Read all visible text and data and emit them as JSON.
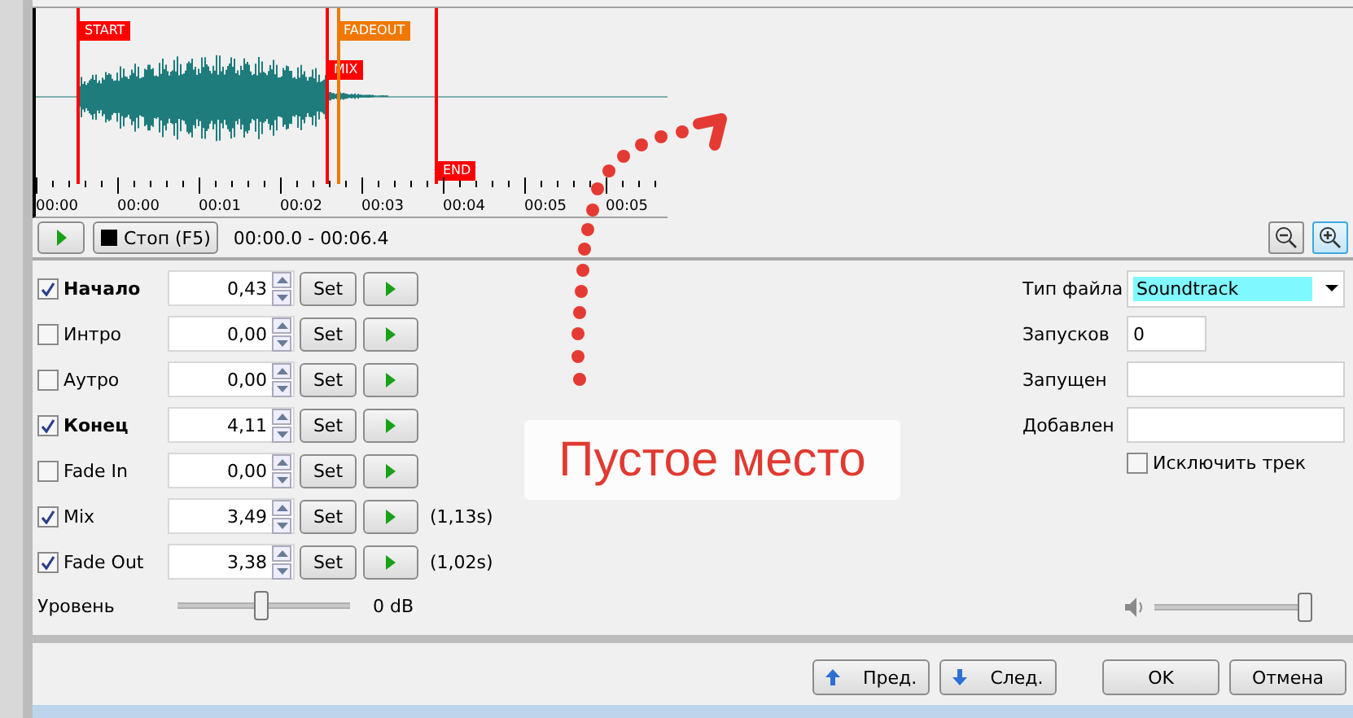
{
  "waveform": {
    "markers": [
      {
        "label": "START",
        "color": "#ff0000"
      },
      {
        "label": "MIX",
        "color": "#ff0000"
      },
      {
        "label": "FADEOUT",
        "color": "#f07800"
      },
      {
        "label": "END",
        "color": "#ff0000"
      }
    ],
    "ticks": [
      "00:00",
      "00:00",
      "00:01",
      "00:02",
      "00:03",
      "00:04",
      "00:05",
      "00:05"
    ]
  },
  "transport": {
    "stop_label": "Стоп (F5)",
    "range": "00:00.0 - 00:06.4"
  },
  "cues": [
    {
      "label": "Начало",
      "checked": true,
      "bold": true,
      "value": "0,43",
      "button": "Set"
    },
    {
      "label": "Интро",
      "checked": false,
      "bold": false,
      "value": "0,00",
      "button": "Set"
    },
    {
      "label": "Аутро",
      "checked": false,
      "bold": false,
      "value": "0,00",
      "button": "Set"
    },
    {
      "label": "Конец",
      "checked": true,
      "bold": true,
      "value": "4,11",
      "button": "Set"
    },
    {
      "label": "Fade In",
      "checked": false,
      "bold": false,
      "value": "0,00",
      "button": "Set"
    },
    {
      "label": "Mix",
      "checked": true,
      "bold": false,
      "value": "3,49",
      "button": "Set",
      "note": "(1,13s)"
    },
    {
      "label": "Fade Out",
      "checked": true,
      "bold": false,
      "value": "3,38",
      "button": "Set",
      "note": "(1,02s)"
    }
  ],
  "level": {
    "label": "Уровень",
    "level": 0.48,
    "reading": "0 dB"
  },
  "properties": {
    "file_type_label": "Тип файла",
    "file_type": "Soundtrack",
    "plays_label": "Запусков",
    "plays": "0",
    "played_label": "Запущен",
    "added_label": "Добавлен",
    "exclude_label": "Исключить трек",
    "exclude": false
  },
  "volume": {
    "level": 1
  },
  "annotation": {
    "text": "Пустое место"
  },
  "buttons": [
    {
      "label": "Пред.",
      "kind": "prev"
    },
    {
      "label": "След.",
      "kind": "next"
    },
    {
      "label": "OK",
      "kind": "plain"
    },
    {
      "label": "Отмена",
      "kind": "plain"
    }
  ]
}
